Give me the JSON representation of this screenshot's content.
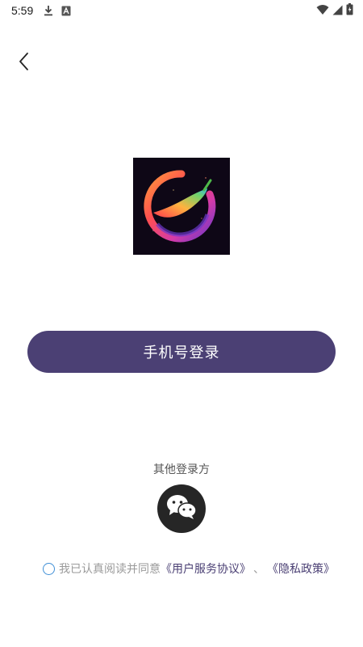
{
  "status_bar": {
    "time": "5:59",
    "left_icons": [
      "download-icon",
      "a-notification-icon"
    ],
    "right_icons": [
      "wifi-icon",
      "signal-icon",
      "battery-icon"
    ]
  },
  "header": {
    "back_icon": "chevron-left-icon"
  },
  "logo": {
    "icon": "app-logo-icon"
  },
  "login": {
    "phone_button_label": "手机号登录"
  },
  "other_login": {
    "label": "其他登录方",
    "wechat_icon": "wechat-icon"
  },
  "agreement": {
    "prefix": "我已认真阅读并同意",
    "user_agreement": "《用户服务协议》",
    "separator": "、",
    "privacy_policy": "《隐私政策》"
  },
  "colors": {
    "primary": "#4b4074",
    "checkbox_border": "#3f8fd6",
    "wechat_bg": "#262626",
    "logo_bg": "#0e0716"
  }
}
